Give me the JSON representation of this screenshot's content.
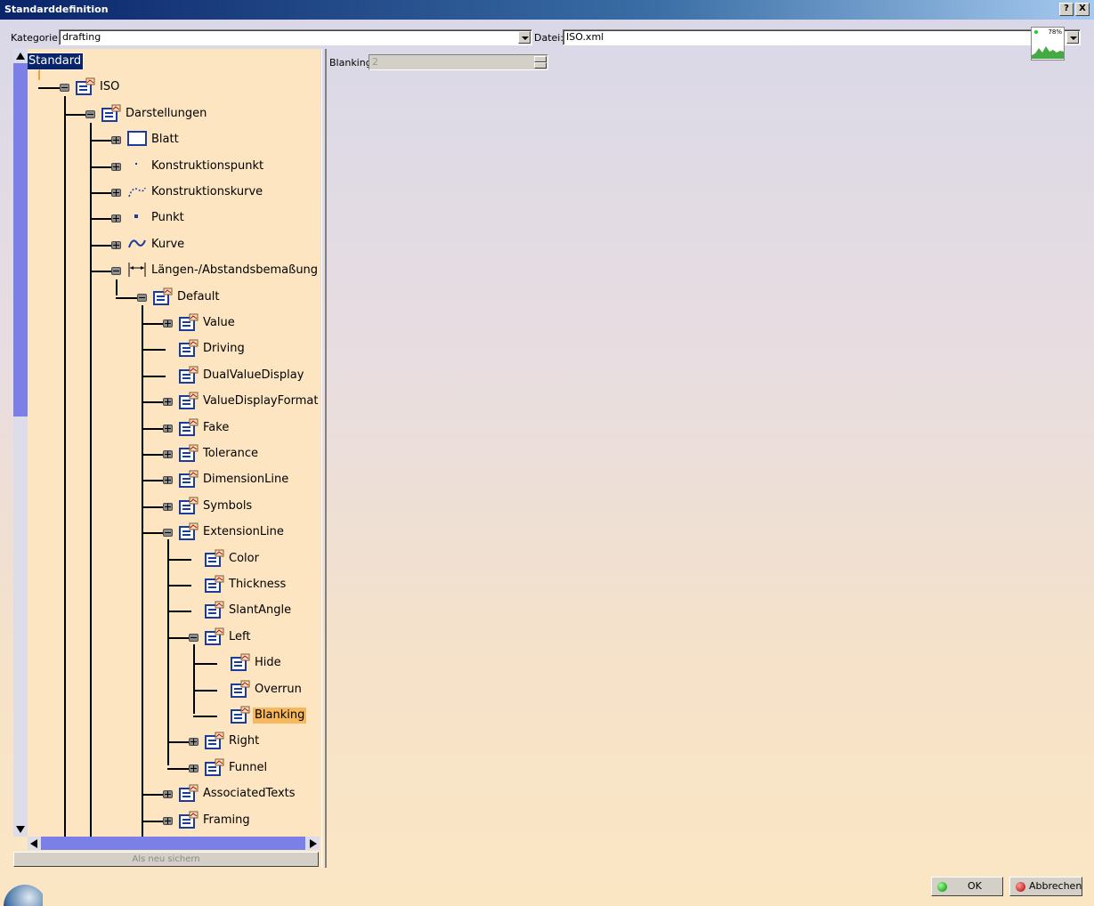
{
  "window": {
    "title": "Standarddefinition",
    "help_btn": "?",
    "close_btn": "X"
  },
  "toolbar": {
    "kategorie_label": "Kategorie:",
    "kategorie_value": "drafting",
    "datei_label": "Datei:",
    "datei_value": "ISO.xml",
    "perf_value": "78%"
  },
  "tree": {
    "items": [
      {
        "label": "Standard",
        "icon": "none",
        "state": "selected"
      },
      {
        "label": "ISO",
        "icon": "node-icon",
        "state": "expanded"
      },
      {
        "label": "Darstellungen",
        "icon": "node-icon",
        "state": "expanded"
      },
      {
        "label": "Blatt",
        "icon": "sheet-icon",
        "state": "collapsed"
      },
      {
        "label": "Konstruktionspunkt",
        "icon": "construction-point-icon",
        "state": "collapsed"
      },
      {
        "label": "Konstruktionskurve",
        "icon": "construction-curve-icon",
        "state": "collapsed"
      },
      {
        "label": "Punkt",
        "icon": "point-icon",
        "state": "collapsed"
      },
      {
        "label": "Kurve",
        "icon": "curve-icon",
        "state": "collapsed"
      },
      {
        "label": "Längen-/Abstandsbemaßung",
        "icon": "dimension-icon",
        "state": "expanded"
      },
      {
        "label": "Default",
        "icon": "node-icon",
        "state": "expanded"
      },
      {
        "label": "Value",
        "icon": "node-icon",
        "state": "collapsed"
      },
      {
        "label": "Driving",
        "icon": "node-icon",
        "state": "leaf"
      },
      {
        "label": "DualValueDisplay",
        "icon": "node-icon",
        "state": "leaf"
      },
      {
        "label": "ValueDisplayFormat",
        "icon": "node-icon",
        "state": "collapsed"
      },
      {
        "label": "Fake",
        "icon": "node-icon",
        "state": "collapsed"
      },
      {
        "label": "Tolerance",
        "icon": "node-icon",
        "state": "collapsed"
      },
      {
        "label": "DimensionLine",
        "icon": "node-icon",
        "state": "collapsed"
      },
      {
        "label": "Symbols",
        "icon": "node-icon",
        "state": "collapsed"
      },
      {
        "label": "ExtensionLine",
        "icon": "node-icon",
        "state": "expanded"
      },
      {
        "label": "Color",
        "icon": "node-icon",
        "state": "leaf"
      },
      {
        "label": "Thickness",
        "icon": "node-icon",
        "state": "leaf"
      },
      {
        "label": "SlantAngle",
        "icon": "node-icon",
        "state": "leaf"
      },
      {
        "label": "Left",
        "icon": "node-icon",
        "state": "expanded"
      },
      {
        "label": "Hide",
        "icon": "node-icon",
        "state": "leaf"
      },
      {
        "label": "Overrun",
        "icon": "node-icon",
        "state": "leaf"
      },
      {
        "label": "Blanking",
        "icon": "node-icon",
        "state": "highlighted"
      },
      {
        "label": "Right",
        "icon": "node-icon",
        "state": "collapsed"
      },
      {
        "label": "Funnel",
        "icon": "node-icon",
        "state": "collapsed"
      },
      {
        "label": "AssociatedTexts",
        "icon": "node-icon",
        "state": "collapsed"
      },
      {
        "label": "Framing",
        "icon": "node-icon",
        "state": "collapsed"
      }
    ]
  },
  "save_button": "Als neu sichern",
  "property": {
    "label": "Blanking",
    "value": "2"
  },
  "footer": {
    "ok": "OK",
    "cancel": "Abbrechen"
  },
  "colors": {
    "selection": "#0a246a",
    "highlight": "#f7b75c",
    "tree_bg": "#fde5c1",
    "scroll_thumb": "#7b7fe8"
  }
}
